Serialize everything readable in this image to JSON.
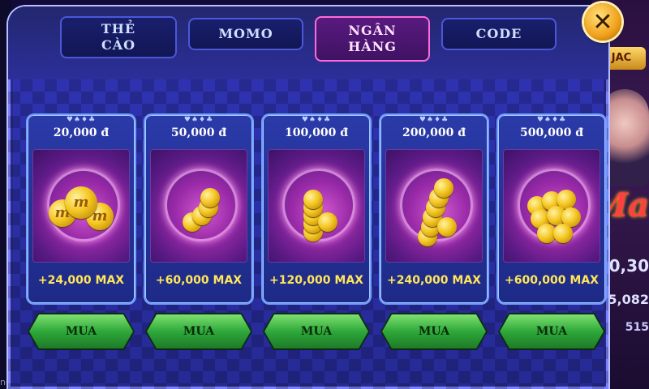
{
  "tabs": [
    {
      "label_line1": "THẺ",
      "label_line2": "CÀO"
    },
    {
      "label": "MOMO"
    },
    {
      "label_line1": "NGÂN",
      "label_line2": "HÀNG",
      "active": true
    },
    {
      "label": "CODE"
    }
  ],
  "close_icon": "close-x",
  "card_suits": "♥♠♦♣",
  "packages": [
    {
      "price": "20,000 đ",
      "bonus": "+24,000 MAX",
      "buy_label": "MUA"
    },
    {
      "price": "50,000 đ",
      "bonus": "+60,000 MAX",
      "buy_label": "MUA"
    },
    {
      "price": "100,000 đ",
      "bonus": "+120,000 MAX",
      "buy_label": "MUA"
    },
    {
      "price": "200,000 đ",
      "bonus": "+240,000 MAX",
      "buy_label": "MUA"
    },
    {
      "price": "500,000 đ",
      "bonus": "+600,000 MAX",
      "buy_label": "MUA"
    }
  ],
  "background": {
    "jackpot_label": "JAC",
    "values": [
      "0,30",
      "5,082",
      "515"
    ],
    "left_fragment": "nc"
  },
  "colors": {
    "accent_gold": "#ffe65a",
    "buy_green": "#2ea83a",
    "active_tab": "#3e1262",
    "panel_blue": "#2a2fa4"
  }
}
